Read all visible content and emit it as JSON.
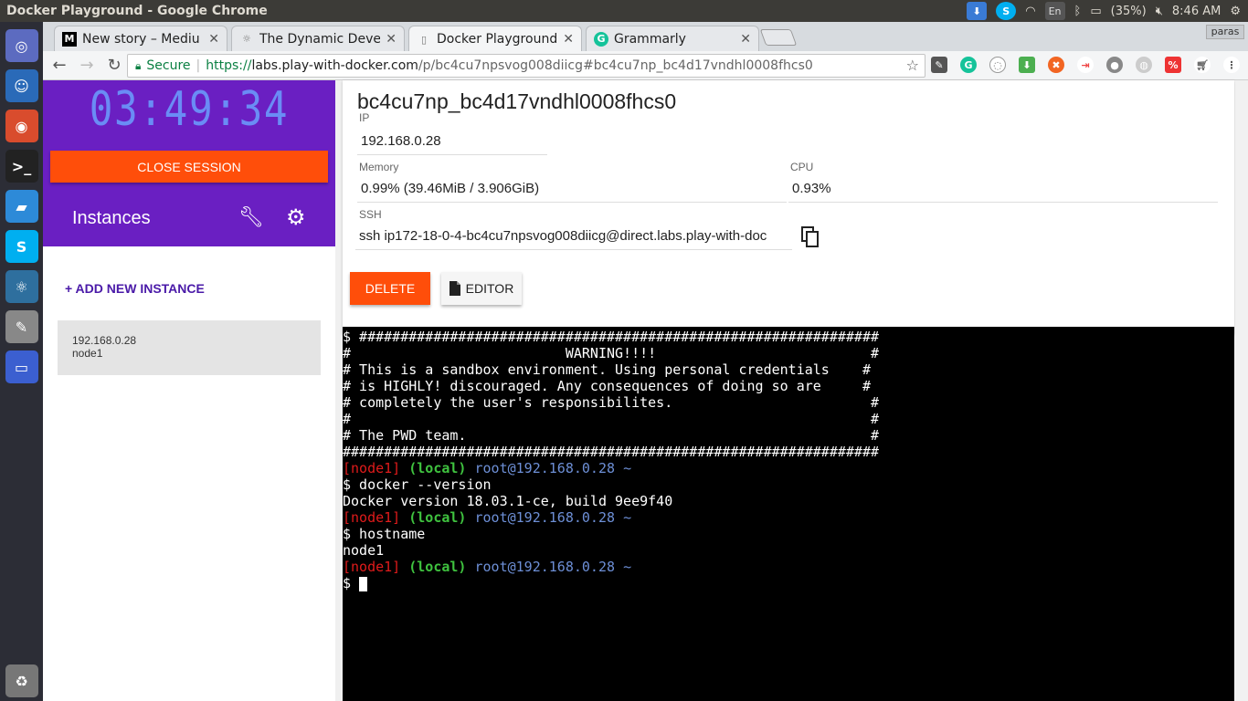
{
  "system": {
    "window_title": "Docker Playground - Google Chrome",
    "keyboard": "En",
    "battery": "(35%)",
    "time": "8:46 AM"
  },
  "launcher": {
    "apps": [
      "ubuntu-icon",
      "finder-icon",
      "chrome-icon",
      "terminal-icon",
      "whale-icon",
      "skype-icon",
      "atom-icon",
      "text-editor-icon",
      "window-icon",
      "trash-icon"
    ]
  },
  "browser": {
    "tabs": [
      {
        "label": "New story – Mediu",
        "favicon": "M"
      },
      {
        "label": "The Dynamic Devel",
        "favicon": "☼"
      },
      {
        "label": "Docker Playground",
        "favicon": "▯"
      },
      {
        "label": "Grammarly",
        "favicon": "G"
      }
    ],
    "profile": "paras",
    "secure_label": "Secure",
    "url_scheme": "https://",
    "url_host": "labs.play-with-docker.com",
    "url_path": "/p/bc4cu7npsvog008diicg#bc4cu7np_bc4d17vndhl0008fhcs0"
  },
  "sidebar": {
    "timer": "03:49:34",
    "close_session": "CLOSE SESSION",
    "instances_title": "Instances",
    "add_instance": "+ ADD NEW INSTANCE",
    "instance_ip": "192.168.0.28",
    "instance_name": "node1"
  },
  "detail": {
    "hostname": "bc4cu7np_bc4d17vndhl0008fhcs0",
    "ip_label": "IP",
    "ip_value": "192.168.0.28",
    "memory_label": "Memory",
    "memory_value": "0.99% (39.46MiB / 3.906GiB)",
    "cpu_label": "CPU",
    "cpu_value": "0.93%",
    "ssh_label": "SSH",
    "ssh_value": "ssh ip172-18-0-4-bc4cu7npsvog008diicg@direct.labs.play-with-doc",
    "delete_label": "DELETE",
    "editor_label": "EDITOR"
  },
  "terminal": {
    "banner": [
      "$ ###############################################################",
      "#                          WARNING!!!!                          #",
      "# This is a sandbox environment. Using personal credentials    #",
      "# is HIGHLY! discouraged. Any consequences of doing so are     #",
      "# completely the user's responsibilites.                        #",
      "#                                                               #",
      "# The PWD team.                                                 #",
      "#################################################################"
    ],
    "prompt_node": "[node1]",
    "prompt_local": "(local)",
    "prompt_user": "root@192.168.0.28",
    "prompt_tilde": "~",
    "cmd1": "$ docker --version",
    "out1": "Docker version 18.03.1-ce, build 9ee9f40",
    "cmd2": "$ hostname",
    "out2": "node1",
    "final_prompt": "$ "
  }
}
